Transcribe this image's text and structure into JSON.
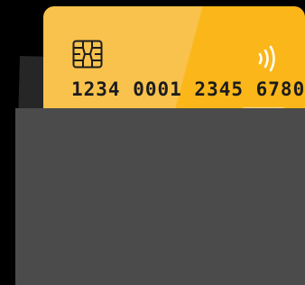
{
  "card": {
    "number": "1234 0001 2345 6780",
    "colors": {
      "light": "#f8c24c",
      "dark": "#fbb619",
      "ink": "#1c1c1c"
    },
    "chip_icon": "sim-chip-icon",
    "contactless_icon": "contactless-waves-icon"
  },
  "wallet": {
    "front_color": "#4a4b4a",
    "back_color": "#262626"
  },
  "background": "#000000"
}
